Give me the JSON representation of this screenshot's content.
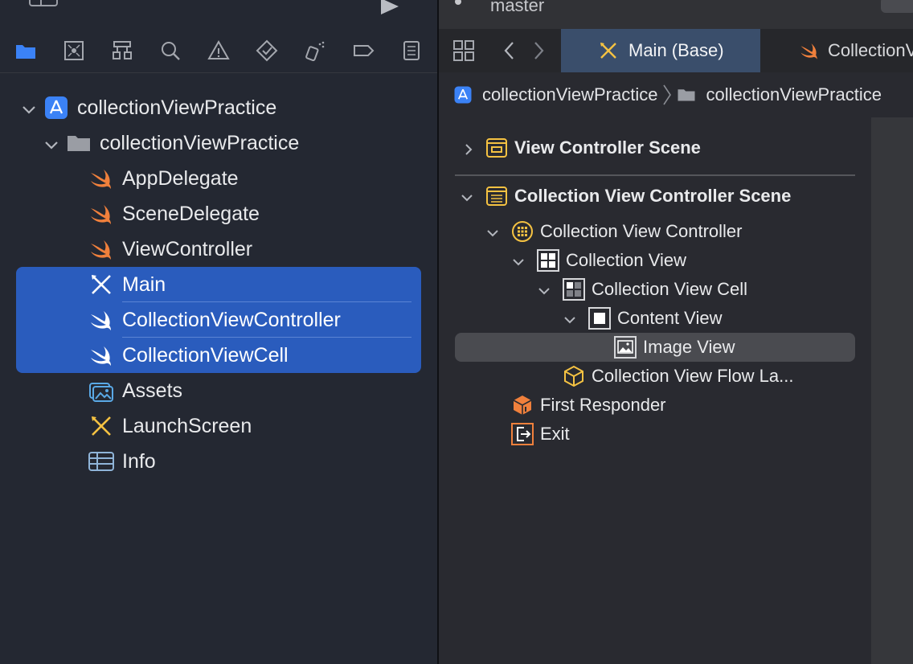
{
  "project_navigator": {
    "tree": [
      {
        "label": "collectionViewPractice",
        "icon": "app-project-icon",
        "expanded": true,
        "selected": false
      },
      {
        "label": "collectionViewPractice",
        "icon": "folder-icon",
        "expanded": true,
        "selected": false
      },
      {
        "label": "AppDelegate",
        "icon": "swift-file-icon",
        "selected": false
      },
      {
        "label": "SceneDelegate",
        "icon": "swift-file-icon",
        "selected": false
      },
      {
        "label": "ViewController",
        "icon": "swift-file-icon",
        "selected": false
      },
      {
        "label": "Main",
        "icon": "storyboard-icon",
        "selected": true
      },
      {
        "label": "CollectionViewController",
        "icon": "swift-file-icon",
        "selected": true
      },
      {
        "label": "CollectionViewCell",
        "icon": "swift-file-icon",
        "selected": true
      },
      {
        "label": "Assets",
        "icon": "asset-catalog-icon",
        "selected": false
      },
      {
        "label": "LaunchScreen",
        "icon": "storyboard-icon",
        "selected": false
      },
      {
        "label": "Info",
        "icon": "plist-icon",
        "selected": false
      }
    ],
    "toolbar_icons": [
      "folder-icon",
      "source-control-icon",
      "hierarchy-icon",
      "search-icon",
      "warning-icon",
      "test-icon",
      "debug-icon",
      "breakpoint-icon",
      "report-icon"
    ]
  },
  "editor": {
    "branch": "master",
    "tabs": [
      {
        "label": "Main (Base)",
        "active": true
      },
      {
        "label": "CollectionV",
        "active": false
      }
    ],
    "jumpbar": {
      "project": "collectionViewPractice",
      "folder": "collectionViewPractice"
    },
    "outline": [
      {
        "label": "View Controller Scene",
        "bold": true,
        "expanded": false
      },
      {
        "label": "Collection View Controller Scene",
        "bold": true,
        "expanded": true
      },
      {
        "label": "Collection View Controller",
        "expanded": true
      },
      {
        "label": "Collection View",
        "expanded": true
      },
      {
        "label": "Collection View Cell",
        "expanded": true
      },
      {
        "label": "Content View",
        "expanded": true
      },
      {
        "label": "Image View",
        "selected": true
      },
      {
        "label": "Collection View Flow La..."
      },
      {
        "label": "First Responder"
      },
      {
        "label": "Exit"
      }
    ]
  },
  "colors": {
    "selection_blue": "#2a5cbd",
    "swift_orange": "#f0803c",
    "storyboard_yellow": "#f5c242",
    "accent_blue": "#3b82f6"
  }
}
